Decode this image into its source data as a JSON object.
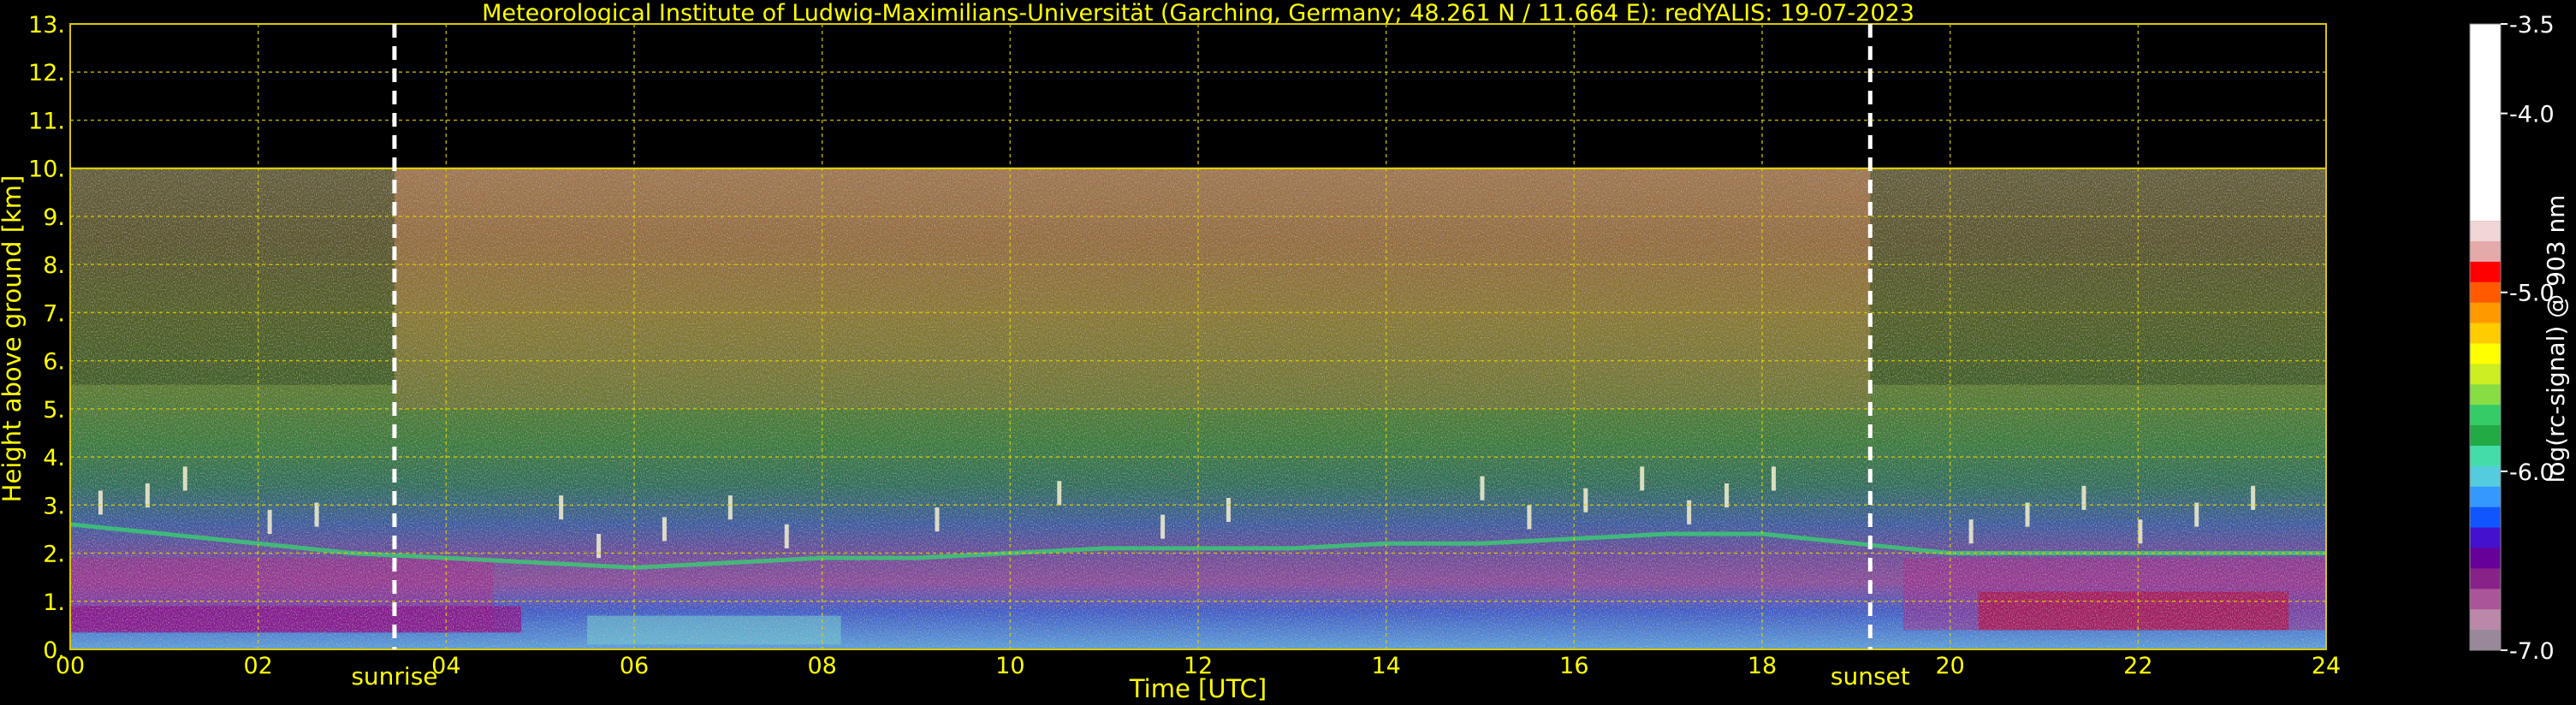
{
  "chart_data": {
    "type": "heatmap",
    "title": "Meteorological Institute of Ludwig-Maximilians-Universität (Garching, Germany; 48.261 N / 11.664 E):    redYALIS: 19-07-2023",
    "xlabel": "Time [UTC]",
    "ylabel": "Height above ground [km]",
    "xlim": [
      0,
      24
    ],
    "ylim": [
      0,
      13
    ],
    "x_ticks": [
      "00",
      "02",
      "04",
      "06",
      "08",
      "10",
      "12",
      "14",
      "16",
      "18",
      "20",
      "22",
      "24"
    ],
    "y_ticks": [
      "0.",
      "1.",
      "2.",
      "3.",
      "4.",
      "5.",
      "6.",
      "7.",
      "8.",
      "9.",
      "10.",
      "11.",
      "12.",
      "13."
    ],
    "grid": true,
    "data_top_km": 10.0,
    "events": [
      {
        "label": "sunrise",
        "time": 3.45
      },
      {
        "label": "sunset",
        "time": 19.15
      }
    ],
    "colorbar": {
      "label": "log(rc-signal) @ 903 nm",
      "ticks": [
        "-3.5",
        "-4.0",
        "-5.0",
        "-6.0",
        "-7.0"
      ],
      "tick_values": [
        -3.5,
        -4.0,
        -5.0,
        -6.0,
        -7.0
      ],
      "range": [
        -7.0,
        -3.5
      ],
      "colors": [
        "#ffffff",
        "#f0d6d6",
        "#e4aaaa",
        "#ff0000",
        "#ff5a00",
        "#ff9900",
        "#ffcc00",
        "#ffff00",
        "#ccee22",
        "#88dd44",
        "#33cc66",
        "#22aa44",
        "#44ddaa",
        "#55ccdd",
        "#3399ff",
        "#1155ff",
        "#4411cc",
        "#660099",
        "#882288",
        "#aa5599",
        "#bb88aa",
        "#998899"
      ]
    },
    "layers": {
      "aerosol_layer_top_km": [
        2.6,
        2.4,
        2.2,
        2.0,
        1.9,
        1.8,
        1.7,
        1.8,
        1.9,
        1.9,
        2.0,
        2.1,
        2.1,
        2.1,
        2.2,
        2.2,
        2.3,
        2.4,
        2.4,
        2.2,
        2.0,
        2.0,
        2.0,
        2.0,
        2.0
      ],
      "cloud_patch_times": [
        0.3,
        0.8,
        1.2,
        2.1,
        2.6,
        5.2,
        5.6,
        6.3,
        7.0,
        7.6,
        9.2,
        10.5,
        11.6,
        12.3,
        15.0,
        15.5,
        16.1,
        16.7,
        17.2,
        17.6,
        18.1,
        20.2,
        20.8,
        21.4,
        22.0,
        22.6,
        23.2
      ]
    }
  }
}
